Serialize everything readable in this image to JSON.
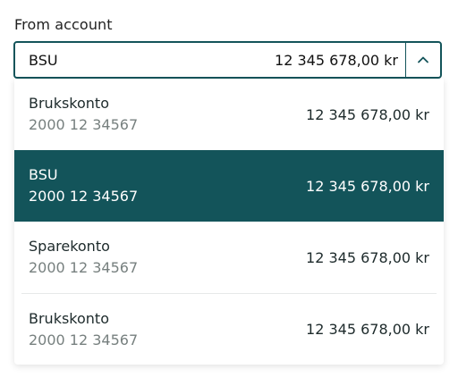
{
  "field": {
    "label": "From account",
    "selected_name": "BSU",
    "selected_amount": "12 345 678,00 kr",
    "toggle_icon": "chevron-up-icon"
  },
  "colors": {
    "accent": "#13545a",
    "muted_text": "#77807f"
  },
  "options": [
    {
      "name": "Brukskonto",
      "number": "2000 12 34567",
      "amount": "12 345 678,00 kr",
      "selected": false
    },
    {
      "name": "BSU",
      "number": "2000 12 34567",
      "amount": "12 345 678,00 kr",
      "selected": true
    },
    {
      "name": "Sparekonto",
      "number": "2000 12 34567",
      "amount": "12 345 678,00 kr",
      "selected": false
    },
    {
      "name": "Brukskonto",
      "number": "2000 12 34567",
      "amount": "12 345 678,00 kr",
      "selected": false
    }
  ]
}
